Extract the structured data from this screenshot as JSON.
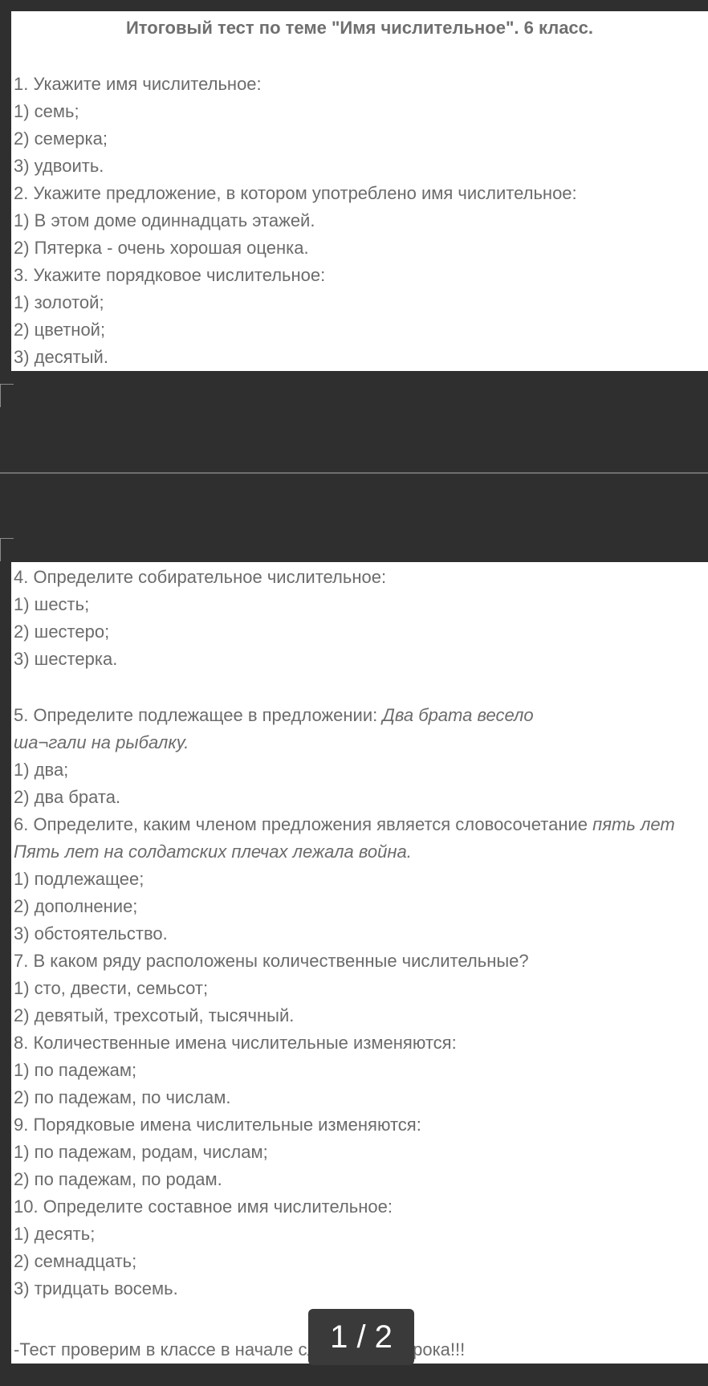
{
  "document": {
    "title": "Итоговый тест по теме \"Имя числительное\". 6 класс.",
    "page1_lines": [
      "1. Укажите имя числительное:",
      "1)   семь;",
      "2) семерка;",
      "3) удвоить.",
      "2. Укажите предложение, в котором употреблено имя числительное:",
      "1) В этом доме одиннадцать этажей.",
      "2) Пятерка - очень хорошая оценка.",
      "3. Укажите порядковое числительное:",
      "1) золотой;",
      "2) цветной;",
      "3) десятый."
    ],
    "q4": {
      "q": "4. Определите собирательное числительное:",
      "a1": "1)   шесть;",
      "a2": "2) шестеро;",
      "a3": "3) шестерка."
    },
    "q5": {
      "q": "5. Определите подлежащее в предложении: ",
      "q_italic": "Два брата весело",
      "q_italic_cont": "ша¬гали на рыбалку.",
      "a1": "1)  два;",
      "a2": "2) два брата."
    },
    "q6": {
      "q": "6. Определите, каким членом предложения является словосочетание ",
      "q_italic": "пять лет",
      "q_italic_cont": "Пять лет на солдатских плечах лежала война.",
      "a1": "1)   подлежащее;",
      "a2": "2) дополнение;",
      "a3": "3)   обстоятельство."
    },
    "q7": {
      "q": "7. В каком ряду расположены количественные числительные?",
      "a1": "1)  сто, двести, семьсот;",
      "a2": "2)  девятый, трехсотый, тысячный."
    },
    "q8": {
      "q": "8. Количественные имена числительные изменяются:",
      "a1": "1)   по падежам;",
      "a2": "2) по падежам, по числам."
    },
    "q9": {
      "q": "9. Порядковые имена числительные изменяются:",
      "a1": "1)   по падежам, родам, числам;",
      "a2": "2) по падежам, по родам."
    },
    "q10": {
      "q": "10. Определите составное имя числительное:",
      "a1": "1) десять;",
      "a2": "2) семнадцать;",
      "a3": "3) тридцать восемь."
    },
    "footer_note": "-Тест проверим в классе в начале следующего урока!!!"
  },
  "viewer": {
    "page_indicator": "1 / 2"
  }
}
